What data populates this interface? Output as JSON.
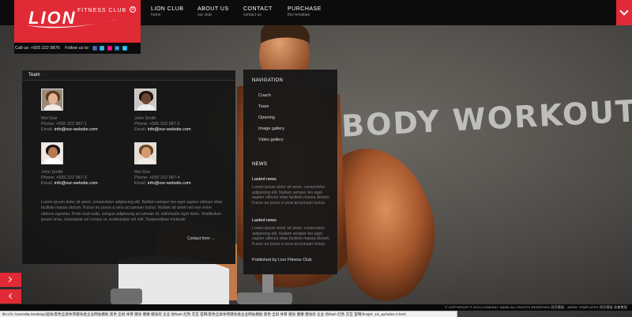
{
  "brand": {
    "logo_text": "LION",
    "logo_sub": "FITNESS CLUB",
    "reg": "R",
    "accent": "#e02a36"
  },
  "callbar": {
    "call_text": "Call us: +555 222 9876",
    "follow_text": "Follow us to:",
    "social": [
      {
        "icon": "facebook-icon",
        "glyph": "f",
        "color": "#3b5998"
      },
      {
        "icon": "twitter-icon",
        "glyph": "t",
        "color": "#29a9e1"
      },
      {
        "icon": "flickr-icon",
        "glyph": "•",
        "color": "#ff0084"
      },
      {
        "icon": "linkedin-icon",
        "glyph": "in",
        "color": "#0e76a8"
      },
      {
        "icon": "vimeo-icon",
        "glyph": "v",
        "color": "#1ab7ea"
      }
    ]
  },
  "nav": [
    {
      "title": "LION CLUB",
      "sub": "home"
    },
    {
      "title": "ABOUT US",
      "sub": "our club"
    },
    {
      "title": "CONTACT",
      "sub": "contact us"
    },
    {
      "title": "PURCHASE",
      "sub": "this template"
    }
  ],
  "team": {
    "heading": "Team",
    "members": [
      {
        "name": "Mel Doe",
        "phone": "Phone: +555 222 987-1",
        "email_label": "Email:",
        "email": "info@our-website.com"
      },
      {
        "name": "John Smith",
        "phone": "Phone: +555 222 987-2",
        "email_label": "Email:",
        "email": "info@our-website.com"
      },
      {
        "name": "John Smith",
        "phone": "Phone: +555 222 987-3",
        "email_label": "Email:",
        "email": "info@our-website.com"
      },
      {
        "name": "Mel Doe",
        "phone": "Phone: +555 222 987-4",
        "email_label": "Email:",
        "email": "info@our-website.com"
      }
    ],
    "paragraph": "Lorem ipsum dolor sit amet, consectetur adipiscing elit. Nullam semper leo eget sapien ultrices vitae facilisis massa dictum. Fusce eu purus a urna accumsan luctus. Nullam sit amet nisi non enim ultrices egestas. Proin erat nulla, congue adipiscing accumsan id, sollicitudin eget dolor. Vestibulum ipsum urna, consequat vel cursus ut, scelerisque vel nisl. Suspendisse molestie.",
    "contact_link": "Contact form →"
  },
  "side": {
    "nav_heading": "NAVIGATION",
    "nav_items": [
      "Coach",
      "Team",
      "Opening",
      "Image gallery",
      "Video gallery"
    ],
    "news_heading": "NEWS",
    "news": [
      {
        "title": "Lasted news",
        "body": "Lorem ipsum dolor sit amet, consectetur adipiscing elit. Nullam semper leo eget sapien ultrices vitae facilisis massa dictum. Fusce eu purus a urna accumsan luctus."
      },
      {
        "title": "Lasted news",
        "body": "Lorem ipsum dolor sit amet, consectetur adipiscing elit. Nullam semper leo eget sapien ultrices vitae facilisis massa dictum. Fusce eu purus a urna accumsan luctus."
      }
    ],
    "published": "Published by Lion Fitness Club"
  },
  "background": {
    "graffiti": "BODY WORKOUT"
  },
  "footer": {
    "copyright": "© COPYRIGHT © 2013 COMPANY NAME ALL RIGHTS RESERVED 网页模板 - MORE TEMPLATES 网页模板 收集整理",
    "status_url": "file:///C:/Users/BL/Desktop/运动/黑色全屏体育健身类企业网站模板 黑色 全屏 体育 健身 健康 健身房 企业 仿flash 红色 交互 官网/黑色全屏体育健身类企业网站模板 黑色 全屏 体育 健身 健康 健身房 企业 仿flash 红色 交互 官网/fmsjs#_16_qu/index-2.html"
  }
}
